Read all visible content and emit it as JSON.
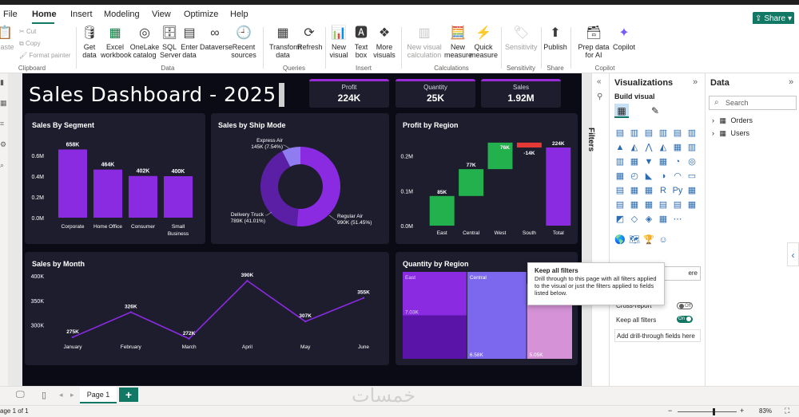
{
  "ribbon": {
    "tabs": [
      "File",
      "Home",
      "Insert",
      "Modeling",
      "View",
      "Optimize",
      "Help"
    ],
    "active_tab": "Home",
    "share": "Share",
    "clipboard": {
      "paste": "Paste",
      "cut": "Cut",
      "copy": "Copy",
      "format_painter": "Format painter",
      "label": "Clipboard"
    },
    "data": {
      "get_data": "Get data",
      "excel": "Excel workbook",
      "onelake": "OneLake catalog",
      "sql": "SQL Server",
      "enter": "Enter data",
      "dataverse": "Dataverse",
      "recent": "Recent sources",
      "label": "Data"
    },
    "queries": {
      "transform": "Transform data",
      "refresh": "Refresh",
      "label": "Queries"
    },
    "insert": {
      "new_visual": "New visual",
      "text_box": "Text box",
      "more_visuals": "More visuals",
      "label": "Insert"
    },
    "calculations": {
      "new_visual_calc": "New visual calculation",
      "new_measure": "New measure",
      "quick_measure": "Quick measure",
      "label": "Calculations"
    },
    "sensitivity": {
      "btn": "Sensitivity",
      "label": "Sensitivity"
    },
    "share_group": {
      "publish": "Publish",
      "label": "Share"
    },
    "copilot": {
      "prep": "Prep data for AI",
      "copilot": "Copilot",
      "label": "Copilot"
    }
  },
  "dashboard": {
    "title": "Sales Dashboard - 2025",
    "kpis": [
      {
        "label": "Profit",
        "value": "224K"
      },
      {
        "label": "Quantity",
        "value": "25K"
      },
      {
        "label": "Sales",
        "value": "1.92M"
      }
    ],
    "accent": "#8a2be2"
  },
  "chart_data": [
    {
      "type": "bar",
      "title": "Sales By Segment",
      "categories": [
        "Corporate",
        "Home Office",
        "Consumer",
        "Small Business"
      ],
      "values": [
        658,
        464,
        402,
        400
      ],
      "data_labels": [
        "658K",
        "464K",
        "402K",
        "400K"
      ],
      "ytick_labels": [
        "0.0M",
        "0.2M",
        "0.4M",
        "0.6M"
      ],
      "ylim": [
        0,
        700
      ]
    },
    {
      "type": "pie",
      "title": "Sales by Ship Mode",
      "slices": [
        {
          "name": "Regular Air",
          "value": 51.45,
          "label_line1": "Regular Air",
          "label_line2": "990K (51.45%)"
        },
        {
          "name": "Delivery Truck",
          "value": 41.01,
          "label_line1": "Delivery Truck",
          "label_line2": "789K (41.01%)"
        },
        {
          "name": "Express Air",
          "value": 7.54,
          "label_line1": "Express Air",
          "label_line2": "145K (7.54%)"
        }
      ],
      "colors": [
        "#8a2be2",
        "#5b1fa6",
        "#8f7cf0"
      ]
    },
    {
      "type": "waterfall",
      "title": "Profit by Region",
      "categories": [
        "East",
        "Central",
        "West",
        "South",
        "Total"
      ],
      "values": [
        85,
        77,
        76,
        -14,
        224
      ],
      "data_labels": [
        "85K",
        "77K",
        "76K",
        "-14K",
        "224K"
      ],
      "ytick_labels": [
        "0.0M",
        "0.1M",
        "0.2M"
      ],
      "ylim": [
        0,
        240
      ],
      "colors": {
        "increase": "#22b14c",
        "decrease": "#e53935",
        "total": "#8a2be2"
      }
    },
    {
      "type": "line",
      "title": "Sales by Month",
      "categories": [
        "January",
        "February",
        "March",
        "April",
        "May",
        "June"
      ],
      "values": [
        275,
        326,
        272,
        390,
        307,
        355
      ],
      "data_labels": [
        "275K",
        "326K",
        "272K",
        "390K",
        "307K",
        "355K"
      ],
      "ytick_labels": [
        "300K",
        "350K",
        "400K"
      ],
      "ylim": [
        270,
        400
      ]
    },
    {
      "type": "treemap",
      "title": "Quantity by Region",
      "regions": [
        {
          "name": "East",
          "label": "East",
          "value": 7.03,
          "value_label": "7.03K"
        },
        {
          "name": "Central",
          "label": "Central",
          "value": 6.58,
          "value_label": "6.58K"
        },
        {
          "name": "South",
          "label": "",
          "value": 5.05,
          "value_label": "5.05K"
        }
      ]
    }
  ],
  "filters": {
    "label": "Filters"
  },
  "visualizations": {
    "title": "Visualizations",
    "build_visual": "Build visual",
    "drill_value": "ere",
    "cross_report": {
      "label": "Cross-report",
      "state": "Off"
    },
    "keep_all_filters": {
      "label": "Keep all filters",
      "state": "On"
    },
    "add_drill": "Add drill-through fields here"
  },
  "data_pane": {
    "title": "Data",
    "search_placeholder": "Search",
    "tables": [
      "Orders",
      "Users"
    ]
  },
  "tooltip": {
    "title": "Keep all filters",
    "body": "Drill through to this page with all filters applied to the visual or just the filters applied to fields listed below."
  },
  "pages": {
    "current": "Page 1",
    "status": "age 1 of 1",
    "zoom": "83%"
  },
  "watermark": "خمسات"
}
